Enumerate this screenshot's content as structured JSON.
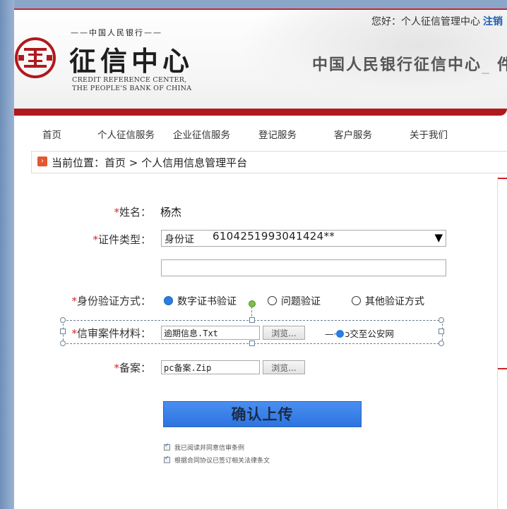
{
  "header": {
    "greeting": "您好：个人征信管理中心",
    "logout": "注销",
    "logo_top": "中国人民银行",
    "logo_main": "征信中心",
    "logo_en_line1": "CREDIT REFERENCE CENTER,",
    "logo_en_line2": "THE PEOPLE'S BANK OF CHINA",
    "banner_title": "中国人民银行征信中心",
    "banner_title_tail": "件"
  },
  "nav": {
    "items": [
      "首页",
      "个人征信服务",
      "企业征信服务",
      "登记服务",
      "客户服务",
      "关于我们"
    ]
  },
  "breadcrumb": {
    "text": "当前位置：首页 > 个人信用信息管理平台"
  },
  "form": {
    "name_label": "姓名：",
    "name_value": "杨杰",
    "id_type_label": "证件类型：",
    "id_type_value": "身份证",
    "id_number": "6104251993041424**",
    "verify_label": "身份验证方式：",
    "verify_options": [
      "数字证书验证",
      "问题验证",
      "其他验证方式"
    ],
    "verify_selected": "数字证书验证",
    "material_label": "信审案件材料：",
    "material_file": "逾期信息.Txt",
    "browse_label": "浏览...",
    "public_text": "ɔ交至公安网",
    "public_prefix": "—·",
    "record_label": "备案：",
    "record_file": "pc备案.Zip",
    "required_mark": "*",
    "confirm_button": "确认上传",
    "agree_lines": [
      "我已阅读并同意信审条例",
      "根据合同协议已签订相关法律条文"
    ]
  },
  "colors": {
    "brand_red": "#b0191e",
    "button_blue": "#2d74e0",
    "radio_on": "#2a7de1"
  }
}
